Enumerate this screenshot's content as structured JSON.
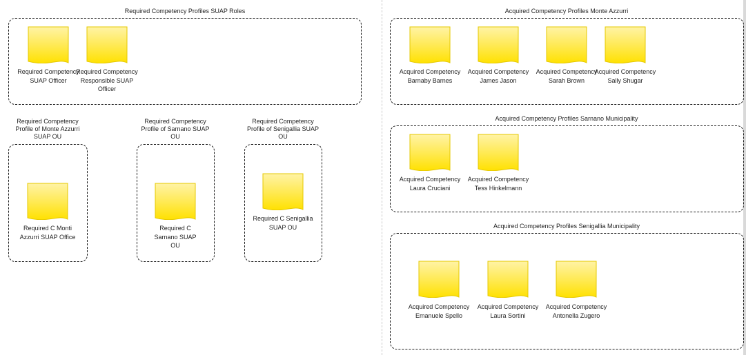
{
  "colors": {
    "doc_fill_top": "#fff3a6",
    "doc_fill_bottom": "#ffe100",
    "doc_stroke": "#e5c800",
    "border": "#1a1a1a"
  },
  "groups": {
    "suap_roles": {
      "title": "Required Competency Profiles SUAP Roles",
      "items": [
        "Required Competency SUAP Officer",
        "Required Competency Responsible SUAP Officer"
      ]
    },
    "monte_azzurri_ou": {
      "title": "Required Competency Profile of Monte Azzurri SUAP OU",
      "items": [
        "Required C Monti Azzurri SUAP Office"
      ]
    },
    "sarnano_ou": {
      "title": "Required Competency Profile of Sarnano SUAP OU",
      "items": [
        "Required C Sarnano SUAP OU"
      ]
    },
    "senigallia_ou": {
      "title": "Required Competency Profile of Senigallia SUAP OU",
      "items": [
        "Required C Senigallia SUAP OU"
      ]
    },
    "acq_monte_azzurri": {
      "title": "Acquired Competency Profiles Monte Azzurri",
      "items": [
        "Acquired Competency Barnaby Barnes",
        "Acquired Competency James Jason",
        "Acquired Competency Sarah Brown",
        "Acquired Competency Sally Shugar"
      ]
    },
    "acq_sarnano": {
      "title": "Acquired Competency Profiles Sarnano Municipality",
      "items": [
        "Acquired Competency Laura Cruciani",
        "Acquired Competency Tess Hinkelmann"
      ]
    },
    "acq_senigallia": {
      "title": "Acquired Competency Profiles Senigallia Municipality",
      "items": [
        "Acquired Competency Emanuele Spello",
        "Acquired Competency Laura Sortini",
        "Acquired Competency Antonella Zugero"
      ]
    }
  }
}
